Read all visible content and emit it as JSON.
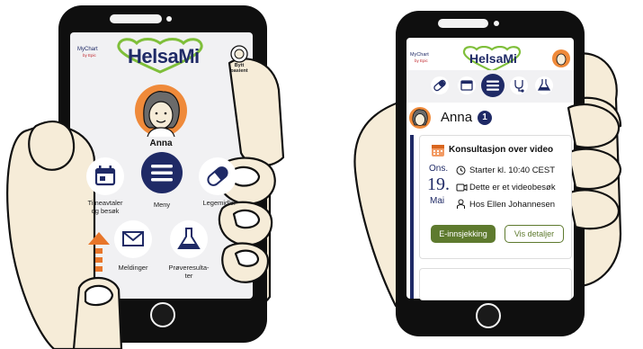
{
  "colors": {
    "navy": "#1f2a66",
    "green_button": "#5e7a2e",
    "skin": "#f6ecd8",
    "avatar_orange": "#ef8a3a",
    "logo_green": "#7fbf3a"
  },
  "left_phone": {
    "brand_small": "MyChart",
    "brand_by": "by Epic",
    "logo": "HelsaMi",
    "top_right_label_line1": "Bytt",
    "top_right_label_line2": "pasient",
    "patient_name": "Anna",
    "menu_items": [
      {
        "label_line1": "Timeavtaler",
        "label_line2": "og besøk",
        "icon": "calendar-icon"
      },
      {
        "label_line1": "Meny",
        "label_line2": "",
        "icon": "menu-icon"
      },
      {
        "label_line1": "Legemidler",
        "label_line2": "",
        "icon": "pill-icon"
      },
      {
        "label_line1": "Meldinger",
        "label_line2": "",
        "icon": "envelope-icon"
      },
      {
        "label_line1": "Prøveresulta-",
        "label_line2": "ter",
        "icon": "flask-icon"
      }
    ]
  },
  "right_phone": {
    "brand_small": "MyChart",
    "brand_by": "by Epic",
    "logo": "HelsaMi",
    "nav_icons": [
      "pill-icon",
      "calendar-icon",
      "menu-icon",
      "stethoscope-icon",
      "flask-icon"
    ],
    "patient_name": "Anna",
    "notification_count": "1",
    "card": {
      "title": "Konsultasjon over video",
      "weekday": "Ons.",
      "day": "19.",
      "month": "Mai",
      "time": "Starter kl. 10:40 CEST",
      "video": "Dette er et videobesøk",
      "provider": "Hos Ellen Johannesen",
      "checkin_button": "E-innsjekking",
      "details_button": "Vis detaljer"
    }
  }
}
